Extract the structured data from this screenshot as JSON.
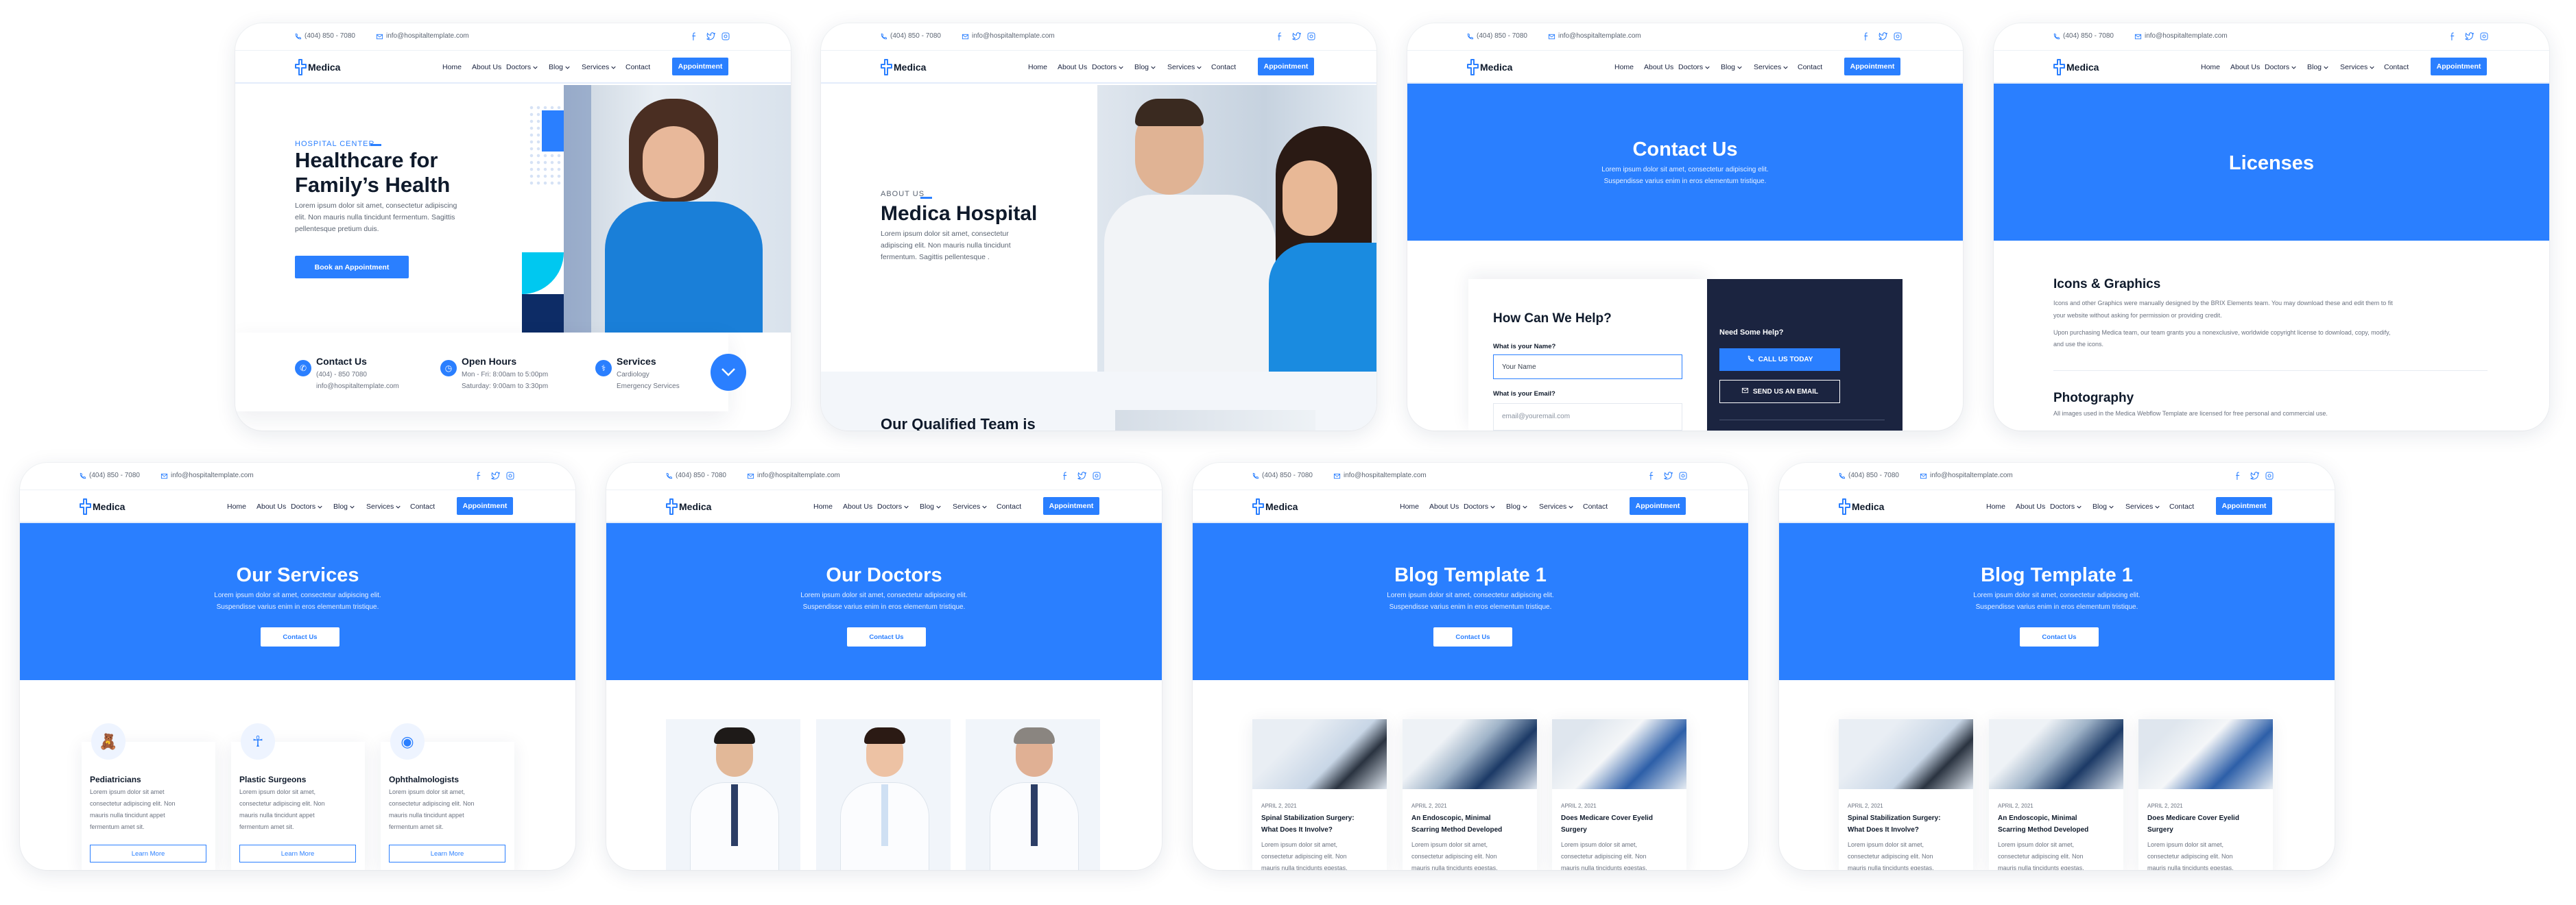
{
  "header": {
    "phone": "(404) 850 - 7080",
    "email": "info@hospitaltemplate.com",
    "logo": "Medica",
    "nav": [
      {
        "label": "Home",
        "dropdown": false
      },
      {
        "label": "About Us",
        "dropdown": false
      },
      {
        "label": "Doctors",
        "dropdown": true
      },
      {
        "label": "Blog",
        "dropdown": true
      },
      {
        "label": "Services",
        "dropdown": true
      },
      {
        "label": "Contact",
        "dropdown": false
      }
    ],
    "appointment": "Appointment",
    "social_icons": [
      "facebook-icon",
      "twitter-icon",
      "instagram-icon"
    ]
  },
  "colors": {
    "brand": "#2a7fff",
    "navy": "#1b2440",
    "cyan": "#00c8f0",
    "dark_block": "#0d2c66"
  },
  "home": {
    "eyebrow": "HOSPITAL CENTER",
    "title_line1": "Healthcare for",
    "title_line2": "Family’s Health",
    "para": [
      "Lorem ipsum dolor sit amet, consectetur adipiscing",
      "elit. Non mauris nulla tincidunt fermentum. Sagittis",
      "pellentesque pretium duis."
    ],
    "cta": "Book an Appointment",
    "info": [
      {
        "icon": "phone-icon",
        "title": "Contact Us",
        "lines": [
          "(404) - 850  7080",
          "info@hospitaltemplate.com"
        ]
      },
      {
        "icon": "clock-icon",
        "title": "Open Hours",
        "lines": [
          "Mon - Fri: 8:00am to 5:00pm",
          "Saturday: 9:00am to 3:30pm"
        ]
      },
      {
        "icon": "caduceus-icon",
        "title": "Services",
        "lines": [
          "Cardiology",
          "Emergency Services"
        ]
      }
    ]
  },
  "about": {
    "eyebrow": "ABOUT US",
    "title": "Medica Hospital",
    "para": [
      "Lorem ipsum dolor sit amet, consectetur",
      "adipiscing elit. Non mauris nulla tincidunt",
      "fermentum. Sagittis pellentesque ."
    ],
    "section_title": "Our Qualified Team is"
  },
  "contact": {
    "title": "Contact Us",
    "sub": [
      "Lorem ipsum dolor sit amet, consectetur adipiscing elit.",
      "Suspendisse varius enim in eros elementum tristique."
    ],
    "form_title": "How Can We Help?",
    "name_label": "What is your Name?",
    "name_placeholder": "Your Name",
    "email_label": "What is your Email?",
    "email_placeholder": "email@youremail.com",
    "help_title": "Need Some Help?",
    "call_btn": "CALL US TODAY",
    "email_btn": "SEND US AN EMAIL"
  },
  "licenses": {
    "title": "Licenses",
    "h1": "Icons & Graphics",
    "p1": [
      "Icons and other Graphics were manually designed by the BRIX Elements team. You may download these and edit them to fit",
      "your website without asking for permission or providing credit."
    ],
    "p2": [
      "Upon purchasing Medica team, our team grants you a nonexclusive, worldwide copyright license to download, copy, modify,",
      "and use the icons."
    ],
    "h2": "Photography",
    "p3": [
      "All images used in the Medica Webflow Template are licensed for free personal and commercial use."
    ]
  },
  "services": {
    "title": "Our Services",
    "sub": [
      "Lorem ipsum dolor sit amet, consectetur adipiscing elit.",
      "Suspendisse varius enim in eros elementum tristique."
    ],
    "cta": "Contact Us",
    "cards": [
      {
        "icon": "teddy-bear-icon",
        "title": "Pediatricians",
        "lines": [
          "Lorem ipsum dolor sit amet",
          "consectetur adipiscing elit. Non",
          "mauris nulla tincidunt appet",
          "fermentum amet sit."
        ],
        "btn": "Learn More"
      },
      {
        "icon": "body-icon",
        "title": "Plastic Surgeons",
        "lines": [
          "Lorem ipsum dolor sit amet,",
          "consectetur adipiscing elit. Non",
          "mauris nulla tincidunt appet",
          "fermentum amet sit."
        ],
        "btn": "Learn More"
      },
      {
        "icon": "eye-icon",
        "title": "Ophthalmologists",
        "lines": [
          "Lorem ipsum dolor sit amet,",
          "consectetur adipiscing elit. Non",
          "mauris nulla tincidunt appet",
          "fermentum amet sit."
        ],
        "btn": "Learn More"
      }
    ]
  },
  "doctors": {
    "title": "Our Doctors",
    "sub": [
      "Lorem ipsum dolor sit amet, consectetur adipiscing elit.",
      "Suspendisse varius enim in eros elementum tristique."
    ],
    "cta": "Contact Us"
  },
  "blog": {
    "title": "Blog Template 1",
    "sub": [
      "Lorem ipsum dolor sit amet, consectetur adipiscing elit.",
      "Suspendisse varius enim in eros elementum tristique."
    ],
    "cta": "Contact Us",
    "posts": [
      {
        "date": "APRIL 2, 2021",
        "title": [
          "Spinal Stabilization Surgery:",
          "What Does It Involve?"
        ],
        "lines": [
          "Lorem ipsum dolor sit amet,",
          "consectetur adipiscing elit. Non",
          "mauris nulla tincidunts egestas."
        ]
      },
      {
        "date": "APRIL 2, 2021",
        "title": [
          "An Endoscopic, Minimal",
          "Scarring Method Developed"
        ],
        "lines": [
          "Lorem ipsum dolor sit amet,",
          "consectetur adipiscing elit. Non",
          "mauris nulla tincidunts egestas."
        ]
      },
      {
        "date": "APRIL 2, 2021",
        "title": [
          "Does Medicare Cover Eyelid",
          "Surgery"
        ],
        "lines": [
          "Lorem ipsum dolor sit amet,",
          "consectetur adipiscing elit. Non",
          "mauris nulla tincidunts egestas."
        ]
      }
    ]
  }
}
